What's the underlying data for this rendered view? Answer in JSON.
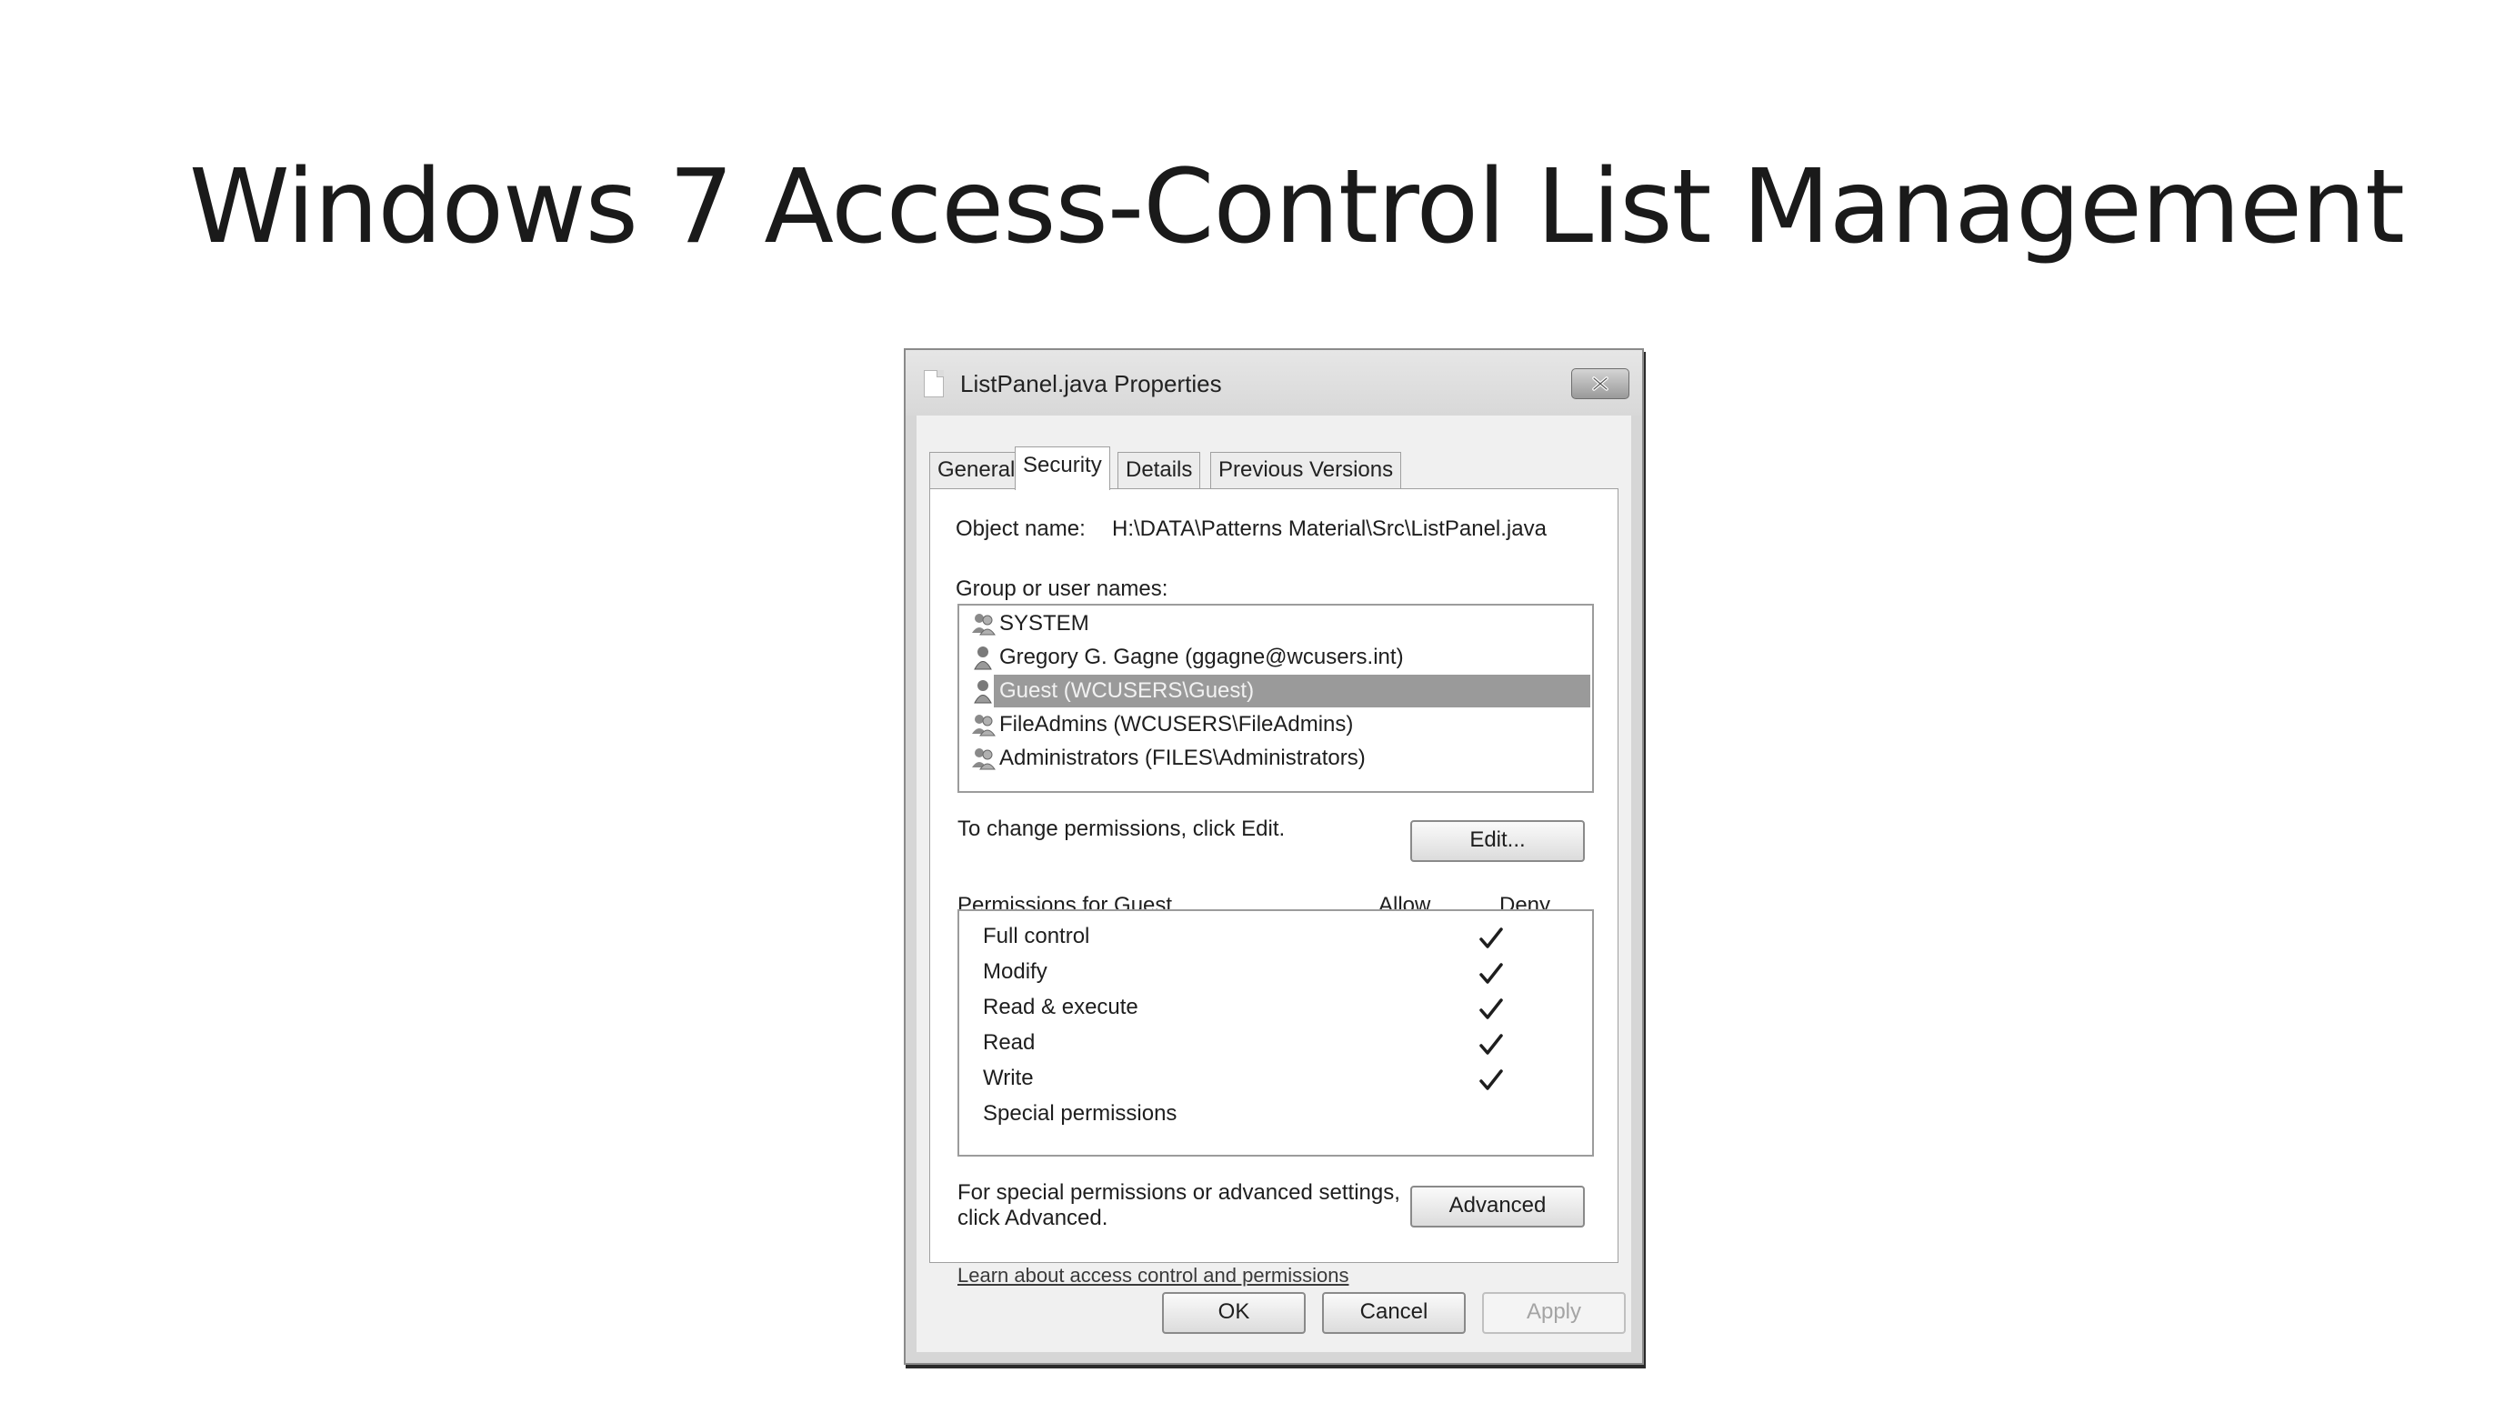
{
  "slide": {
    "title": "Windows 7 Access-Control List Management"
  },
  "window": {
    "title": "ListPanel.java Properties",
    "icon": "document-icon",
    "close_icon": "close-icon"
  },
  "tabs": [
    {
      "label": "General",
      "active": false
    },
    {
      "label": "Security",
      "active": true
    },
    {
      "label": "Details",
      "active": false
    },
    {
      "label": "Previous Versions",
      "active": false
    }
  ],
  "security": {
    "object_name_label": "Object name:",
    "object_name_value": "H:\\DATA\\Patterns Material\\Src\\ListPanel.java",
    "group_label": "Group or user names:",
    "users": [
      {
        "name": "SYSTEM",
        "icon": "group-icon",
        "selected": false
      },
      {
        "name": "Gregory G. Gagne (ggagne@wcusers.int)",
        "icon": "user-icon",
        "selected": false
      },
      {
        "name": "Guest (WCUSERS\\Guest)",
        "icon": "user-icon",
        "selected": true
      },
      {
        "name": "FileAdmins (WCUSERS\\FileAdmins)",
        "icon": "group-icon",
        "selected": false
      },
      {
        "name": "Administrators (FILES\\Administrators)",
        "icon": "group-icon",
        "selected": false
      }
    ],
    "change_text": "To change permissions, click Edit.",
    "edit_button": "Edit...",
    "permissions_for": "Permissions for Guest",
    "allow_header": "Allow",
    "deny_header": "Deny",
    "permissions": [
      {
        "name": "Full control",
        "allow": false,
        "deny": true
      },
      {
        "name": "Modify",
        "allow": false,
        "deny": true
      },
      {
        "name": "Read & execute",
        "allow": false,
        "deny": true
      },
      {
        "name": "Read",
        "allow": false,
        "deny": true
      },
      {
        "name": "Write",
        "allow": false,
        "deny": true
      },
      {
        "name": "Special permissions",
        "allow": false,
        "deny": false
      }
    ],
    "advanced_text_line1": "For special permissions or advanced settings,",
    "advanced_text_line2": "click Advanced.",
    "advanced_button": "Advanced",
    "learn_link": "Learn about access control and permissions"
  },
  "footer": {
    "ok": "OK",
    "cancel": "Cancel",
    "apply": "Apply",
    "apply_enabled": false
  },
  "colors": {
    "selection": "#9a9a9a",
    "dialog_frame": "#d6d6d6",
    "client_bg": "#f0f0f0"
  }
}
